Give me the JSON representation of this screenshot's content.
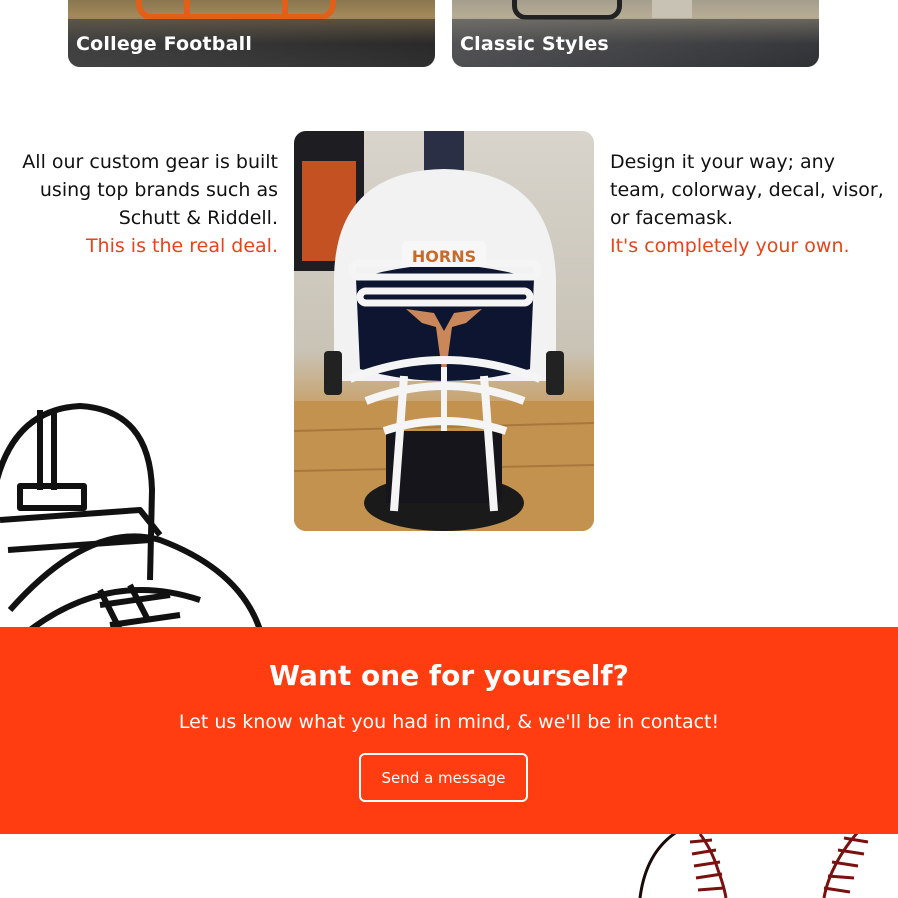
{
  "categories": {
    "card_1_title": "College Football",
    "card_2_title": "Classic Styles"
  },
  "intro": {
    "left_text": "All our custom gear is built using top brands such as Schutt & Riddell.",
    "left_accent": "This is the real deal.",
    "right_text": "Design it your way; any team, colorway, decal, visor, or facemask.",
    "right_accent": "It's completely your own."
  },
  "photo": {
    "helmet_decal": "HORNS"
  },
  "cta": {
    "title": "Want one for yourself?",
    "subtitle": "Let us know what you had in mind, & we'll be in contact!",
    "button_label": "Send a message"
  },
  "colors": {
    "accent": "#e8431a",
    "cta_background": "#ff3d10",
    "text": "#111111",
    "baseball_stitch": "#7a1010"
  }
}
